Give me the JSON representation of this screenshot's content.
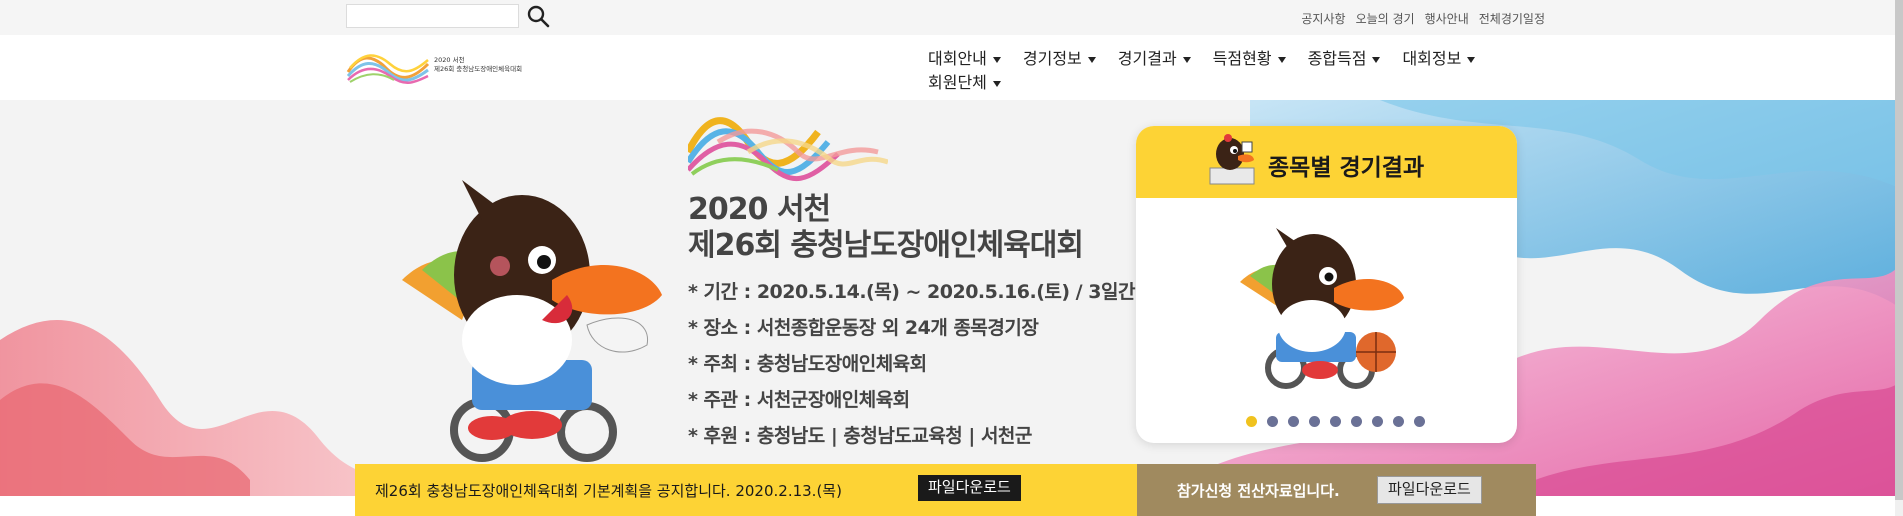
{
  "search": {
    "placeholder": "",
    "button_icon": "search-icon"
  },
  "utility_links": [
    "공지사항",
    "오늘의 경기",
    "행사안내",
    "전체경기일정"
  ],
  "logo": {
    "line1": "2020 서천",
    "line2": "제26회 충청남도장애인체육대회"
  },
  "nav": [
    {
      "label": "대회안내"
    },
    {
      "label": "경기정보"
    },
    {
      "label": "경기결과"
    },
    {
      "label": "득점현황"
    },
    {
      "label": "종합득점"
    },
    {
      "label": "대회정보"
    },
    {
      "label": "회원단체"
    }
  ],
  "hero": {
    "title_line1": "2020 서천",
    "title_line2": "제26회 충청남도장애인체육대회",
    "info": [
      "* 기간 : 2020.5.14.(목) ~ 2020.5.16.(토) / 3일간",
      "* 장소 : 서천종합운동장 외 24개 종목경기장",
      "* 주최 :  충청남도장애인체육회",
      "* 주관 : 서천군장애인체육회",
      "* 후원 : 충청남도 | 충청남도교육청 | 서천군"
    ]
  },
  "card": {
    "title": "종목별 경기결과",
    "dot_count": 9,
    "active_dot": 0
  },
  "notice": {
    "left_text": "제26회 충청남도장애인체육대회 기본계획을 공지합니다. 2020.2.13.(목)",
    "left_button": "파일다운로드",
    "right_text": "참가신청 전산자료입니다.",
    "right_button": "파일다운로드"
  },
  "colors": {
    "accent_yellow": "#fdd335",
    "notice_brown": "#a08a5f",
    "dot_inactive": "#6a7196",
    "dot_active": "#f0c21e"
  }
}
